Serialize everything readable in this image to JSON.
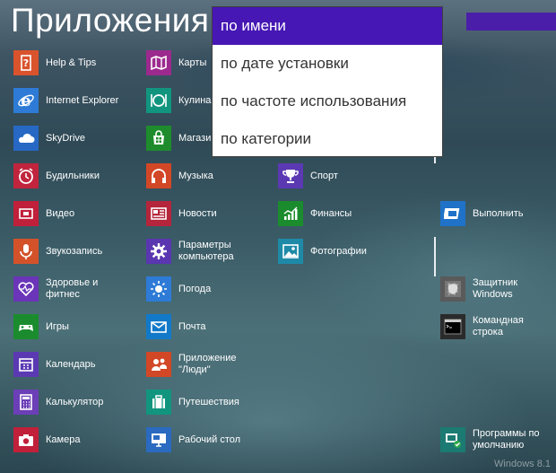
{
  "header": {
    "title": "Приложения"
  },
  "sort_menu": {
    "options": [
      "по имени",
      "по дате установки",
      "по частоте использования",
      "по категории"
    ],
    "selected": "по имени"
  },
  "apps": {
    "col1": [
      {
        "label": "Help & Tips",
        "color": "#d9532c",
        "icon": "help-icon"
      },
      {
        "label": "Internet Explorer",
        "color": "#2d7bd6",
        "icon": "ie-icon"
      },
      {
        "label": "SkyDrive",
        "color": "#2668c4",
        "icon": "cloud-icon"
      },
      {
        "label": "Будильники",
        "color": "#c1243d",
        "icon": "alarm-icon"
      },
      {
        "label": "Видео",
        "color": "#c0203a",
        "icon": "video-icon"
      },
      {
        "label": "Звукозапись",
        "color": "#d4522a",
        "icon": "mic-icon"
      },
      {
        "label": "Здоровье и\nфитнес",
        "color": "#6a35b8",
        "icon": "heart-icon"
      },
      {
        "label": "Игры",
        "color": "#1b8c2e",
        "icon": "gamepad-icon"
      },
      {
        "label": "Календарь",
        "color": "#5b39b3",
        "icon": "calendar-icon"
      },
      {
        "label": "Калькулятор",
        "color": "#6b3fb7",
        "icon": "calculator-icon"
      },
      {
        "label": "Камера",
        "color": "#c0203a",
        "icon": "camera-icon"
      }
    ],
    "col2": [
      {
        "label": "Карты",
        "color": "#9c2a8e",
        "icon": "map-icon"
      },
      {
        "label": "Кулинар",
        "color": "#12957f",
        "icon": "food-icon"
      },
      {
        "label": "Магазин",
        "color": "#1e8c2d",
        "icon": "store-icon"
      },
      {
        "label": "Музыка",
        "color": "#d24726",
        "icon": "headphones-icon"
      },
      {
        "label": "Новости",
        "color": "#b5253b",
        "icon": "news-icon"
      },
      {
        "label": "Параметры\nкомпьютера",
        "color": "#5a36b0",
        "icon": "gear-icon"
      },
      {
        "label": "Погода",
        "color": "#2d7bd6",
        "icon": "sun-icon"
      },
      {
        "label": "Почта",
        "color": "#1279c9",
        "icon": "mail-icon"
      },
      {
        "label": "Приложение\n\"Люди\"",
        "color": "#d24726",
        "icon": "people-icon"
      },
      {
        "label": "Путешествия",
        "color": "#12957f",
        "icon": "suitcase-icon"
      },
      {
        "label": "Рабочий стол",
        "color": "#2a6ac0",
        "icon": "desktop-icon"
      }
    ],
    "col3": [
      {
        "label": "Спорт",
        "color": "#5b39b3",
        "icon": "trophy-icon"
      },
      {
        "label": "Финансы",
        "color": "#1b8c2e",
        "icon": "chart-icon"
      },
      {
        "label": "Фотографии",
        "color": "#1e8aa8",
        "icon": "photo-icon"
      }
    ],
    "col4": [
      {
        "label": "Выполнить",
        "color": "#1f72c8",
        "icon": "run-icon"
      },
      {
        "label": "Защитник\nWindows",
        "color": "#5a5a5a",
        "icon": "defender-icon"
      },
      {
        "label": "Командная строка",
        "color": "#2b2b2b",
        "icon": "cmd-icon"
      },
      {
        "label": "Программы по\nумолчанию",
        "color": "#1b7a72",
        "icon": "defaults-icon"
      }
    ]
  },
  "watermark": "Windows 8.1"
}
